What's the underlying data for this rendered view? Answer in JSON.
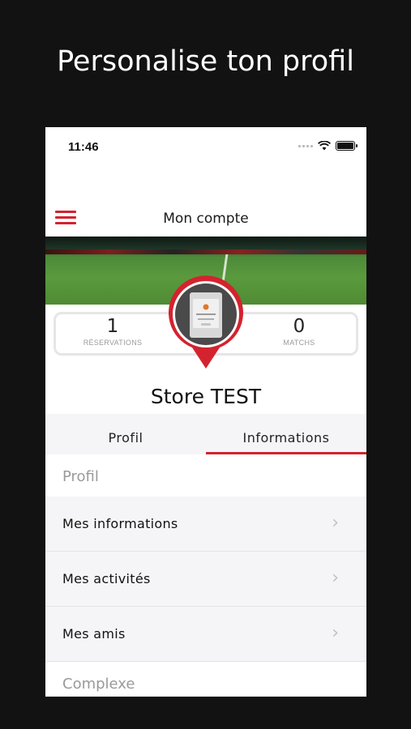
{
  "headline": "Personalise ton profil",
  "status_bar": {
    "time": "11:46",
    "icons": [
      "signal-icon",
      "wifi-icon",
      "battery-icon"
    ]
  },
  "nav": {
    "title": "Mon compte",
    "menu_icon": "hamburger-menu-icon"
  },
  "stats": {
    "reservations": {
      "value": "1",
      "label": "RÉSERVATIONS"
    },
    "matchs": {
      "value": "0",
      "label": "MATCHS"
    }
  },
  "profile": {
    "name": "Store TEST",
    "avatar": "location-pin-avatar"
  },
  "tabs": [
    {
      "label": "Profil",
      "active": false
    },
    {
      "label": "Informations",
      "active": true
    }
  ],
  "sections": {
    "profil": {
      "header": "Profil",
      "items": [
        {
          "label": "Mes informations"
        },
        {
          "label": "Mes activités"
        },
        {
          "label": "Mes amis"
        }
      ]
    },
    "complexe": {
      "header": "Complexe"
    }
  },
  "colors": {
    "accent": "#d3232f",
    "background": "#121212",
    "row_bg": "#f5f5f7"
  }
}
